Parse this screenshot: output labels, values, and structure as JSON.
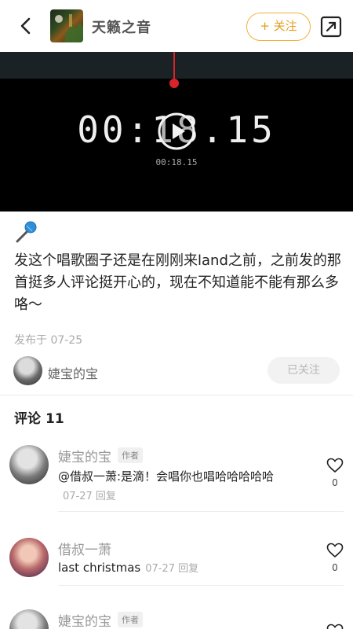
{
  "header": {
    "circle_title": "天籁之音",
    "follow_label": "+ 关注"
  },
  "video": {
    "big_time": "00:18.15",
    "small_time": "00:18.15"
  },
  "post": {
    "text": "发这个唱歌圈子还是在刚刚来land之前，之前发的那首挺多人评论挺开心的，现在不知道能不能有那么多咯～",
    "date": "发布于 07-25",
    "author_name": "婕宝的宝",
    "followed_label": "已关注"
  },
  "comments_section": {
    "label": "评论",
    "count": "11"
  },
  "comments": [
    {
      "name": "婕宝的宝",
      "tag": "作者",
      "text": "@借叔一萧:是滴！会唱你也唱哈哈哈哈哈",
      "meta": "07-27 回复",
      "likes": "0"
    },
    {
      "name": "借叔一萧",
      "tag": "",
      "text": "last christmas",
      "meta": "07-27 回复",
      "likes": "0"
    },
    {
      "name": "婕宝的宝",
      "tag": "作者",
      "text": "",
      "meta": "",
      "likes": ""
    }
  ],
  "colors": {
    "accent": "#f0b23a",
    "video_marker": "#d8232a"
  }
}
